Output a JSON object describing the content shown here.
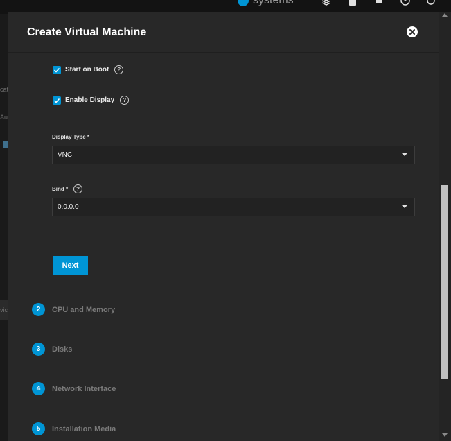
{
  "topbar": {
    "brand_text": "systems",
    "icons": [
      "truecommand-icon",
      "clipboard-icon",
      "bell-icon",
      "account-icon",
      "power-icon"
    ]
  },
  "background": {
    "fragments": [
      "cat",
      "Au",
      "vic"
    ]
  },
  "dialog": {
    "title": "Create Virtual Machine",
    "start_on_boot": {
      "label": "Start on Boot",
      "checked": true
    },
    "enable_display": {
      "label": "Enable Display",
      "checked": true
    },
    "display_type": {
      "label": "Display Type *",
      "value": "VNC"
    },
    "bind": {
      "label": "Bind *",
      "value": "0.0.0.0"
    },
    "next_label": "Next",
    "steps": [
      {
        "num": "2",
        "label": "CPU and Memory"
      },
      {
        "num": "3",
        "label": "Disks"
      },
      {
        "num": "4",
        "label": "Network Interface"
      },
      {
        "num": "5",
        "label": "Installation Media"
      }
    ]
  },
  "colors": {
    "accent": "#0095d5",
    "dialog_bg": "#282828",
    "page_bg": "#1e1e1e"
  }
}
